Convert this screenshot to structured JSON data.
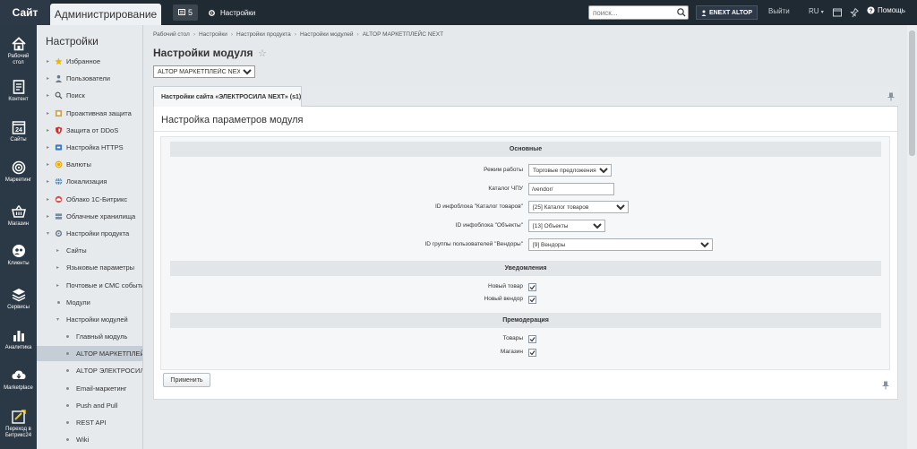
{
  "topbar": {
    "site_tab": "Сайт",
    "admin_tab": "Администрирование",
    "notifications_count": "5",
    "settings_label": "Настройки",
    "search_placeholder": "поиск...",
    "user_button": "ENEXT ALTOP",
    "exit_label": "Выйти",
    "lang_label": "RU",
    "help_label": "Помощь"
  },
  "icon_nav": [
    {
      "label": "Рабочий\nстол",
      "icon": "home-icon"
    },
    {
      "label": "Контент",
      "icon": "document-icon"
    },
    {
      "label": "Сайты",
      "icon": "calendar-icon",
      "badge": "24"
    },
    {
      "label": "Маркетинг",
      "icon": "target-icon"
    },
    {
      "label": "Магазин",
      "icon": "basket-icon"
    },
    {
      "label": "Клиенты",
      "icon": "clients-icon"
    },
    {
      "label": "Сервисы",
      "icon": "layers-icon"
    },
    {
      "label": "Аналитика",
      "icon": "bar-chart-icon"
    },
    {
      "label": "Marketplace",
      "icon": "cloud-download-icon"
    },
    {
      "label": "Переход в\nБитрикс24",
      "icon": "bitrix24-icon"
    }
  ],
  "tree": {
    "title": "Настройки",
    "items": [
      {
        "label": "Избранное",
        "icon": "star-icon"
      },
      {
        "label": "Пользователи",
        "icon": "user-icon"
      },
      {
        "label": "Поиск",
        "icon": "magnifier-icon"
      },
      {
        "label": "Проактивная защита",
        "icon": "proactive-icon"
      },
      {
        "label": "Защита от DDoS",
        "icon": "shield-icon"
      },
      {
        "label": "Настройка HTTPS",
        "icon": "https-icon"
      },
      {
        "label": "Валюты",
        "icon": "currency-icon"
      },
      {
        "label": "Локализация",
        "icon": "globe-icon"
      },
      {
        "label": "Облако 1С-Битрикс",
        "icon": "cloud-icon"
      },
      {
        "label": "Облачные хранилища",
        "icon": "storage-icon"
      },
      {
        "label": "Настройки продукта",
        "icon": "product-settings-icon"
      },
      {
        "label": "Сайты"
      },
      {
        "label": "Языковые параметры"
      },
      {
        "label": "Почтовые и СМС события"
      },
      {
        "label": "Модули"
      },
      {
        "label": "Настройки модулей"
      },
      {
        "label": "Главный модуль"
      },
      {
        "label": "ALTOP МАРКЕТПЛЕЙС NEXT"
      },
      {
        "label": "ALTOP ЭЛЕКТРОСИЛА NEXT"
      },
      {
        "label": "Email-маркетинг"
      },
      {
        "label": "Push and Pull"
      },
      {
        "label": "REST API"
      },
      {
        "label": "Wiki"
      }
    ]
  },
  "breadcrumb": [
    "Рабочий стол",
    "Настройки",
    "Настройки продукта",
    "Настройки модулей",
    "ALTOP МАРКЕТПЛЕЙС NEXT"
  ],
  "page": {
    "title": "Настройки модуля",
    "module_select_value": "ALTOP МАРКЕТПЛЕЙС NEXT"
  },
  "tab": {
    "label": "Настройки сайта «ЭЛЕКТРОСИЛА NEXT» (s1)"
  },
  "panel": {
    "title": "Настройка параметров модуля",
    "sections": [
      {
        "header": "Основные"
      },
      {
        "header": "Уведомления"
      },
      {
        "header": "Премодерация"
      }
    ],
    "fields": {
      "mode_label": "Режим работы",
      "mode_value": "Торговые предложения",
      "catalog_url_label": "Каталог ЧПУ",
      "catalog_url_value": "/vendor/",
      "iblock_catalog_label": "ID инфоблока \"Каталог товаров\"",
      "iblock_catalog_value": "[25] Каталог товаров",
      "iblock_objects_label": "ID инфоблока \"Объекты\"",
      "iblock_objects_value": "[13] Объекты",
      "vendor_group_label": "ID группы пользователей \"Вендоры\"",
      "vendor_group_value": "[9] Вендоры",
      "new_product_label": "Новый товар",
      "new_vendor_label": "Новый вендор",
      "premod_products_label": "Товары",
      "premod_shop_label": "Магазин"
    },
    "apply_label": "Применить"
  },
  "colors": {
    "topbar": "#202a33",
    "icon_nav": "#2b3946",
    "tree_bg": "#e6eaed",
    "section_header": "#e2e6e9"
  }
}
